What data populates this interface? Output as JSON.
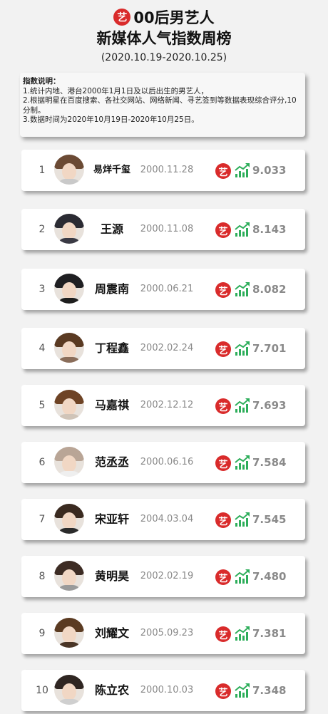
{
  "header": {
    "logo_char": "艺",
    "title_line1": "00后男艺人",
    "title_line2": "新媒体人气指数周榜",
    "date_range": "(2020.10.19-2020.10.25)"
  },
  "notes": {
    "title": "指数说明：",
    "lines": [
      "1.统计内地、港台2000年1月1日及以后出生的男艺人，",
      "2.根据明星在百度搜索、各社交网站、网络新闻、寻艺签到等数据表现综合评分,10分制。",
      "3.数据时间为2020年10月19日-2020年10月25日。"
    ]
  },
  "colors": {
    "accent_red": "#d92b2b",
    "trend_green": "#2eae5b",
    "score_gray": "#8a8a8a"
  },
  "ranking": [
    {
      "rank": "1",
      "name": "易烊千玺",
      "birth": "2000.11.28",
      "score": "9.033",
      "badge": "艺",
      "trend_icon": "trending-up-icon"
    },
    {
      "rank": "2",
      "name": "王源",
      "birth": "2000.11.08",
      "score": "8.143",
      "badge": "艺",
      "trend_icon": "trending-up-icon"
    },
    {
      "rank": "3",
      "name": "周震南",
      "birth": "2000.06.21",
      "score": "8.082",
      "badge": "艺",
      "trend_icon": "trending-up-icon"
    },
    {
      "rank": "4",
      "name": "丁程鑫",
      "birth": "2002.02.24",
      "score": "7.701",
      "badge": "艺",
      "trend_icon": "trending-up-icon"
    },
    {
      "rank": "5",
      "name": "马嘉祺",
      "birth": "2002.12.12",
      "score": "7.693",
      "badge": "艺",
      "trend_icon": "trending-up-icon"
    },
    {
      "rank": "6",
      "name": "范丞丞",
      "birth": "2000.06.16",
      "score": "7.584",
      "badge": "艺",
      "trend_icon": "trending-up-icon"
    },
    {
      "rank": "7",
      "name": "宋亚轩",
      "birth": "2004.03.04",
      "score": "7.545",
      "badge": "艺",
      "trend_icon": "trending-up-icon"
    },
    {
      "rank": "8",
      "name": "黄明昊",
      "birth": "2002.02.19",
      "score": "7.480",
      "badge": "艺",
      "trend_icon": "trending-up-icon"
    },
    {
      "rank": "9",
      "name": "刘耀文",
      "birth": "2005.09.23",
      "score": "7.381",
      "badge": "艺",
      "trend_icon": "trending-up-icon"
    },
    {
      "rank": "10",
      "name": "陈立农",
      "birth": "2000.10.03",
      "score": "7.348",
      "badge": "艺",
      "trend_icon": "trending-up-icon"
    }
  ]
}
